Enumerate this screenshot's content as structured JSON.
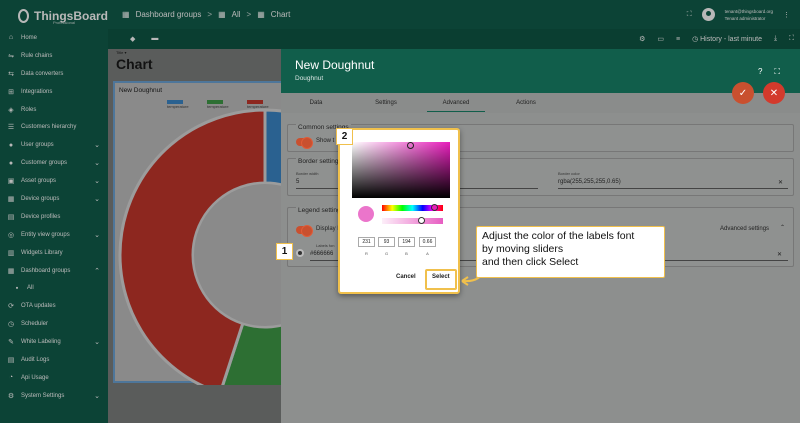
{
  "app": {
    "name": "ThingsBoard",
    "edition": "Professional"
  },
  "breadcrumb": {
    "item1": "Dashboard groups",
    "sep1": ">",
    "item2": "All",
    "sep2": ">",
    "item3": "Chart"
  },
  "user": {
    "email": "tenant@thingsboard.org",
    "role": "Tenant administrator"
  },
  "toolbar": {
    "history": "History - last minute"
  },
  "sidebar": {
    "items": [
      {
        "label": "Home",
        "icon": "home-icon",
        "glyph": "⌂"
      },
      {
        "label": "Rule chains",
        "icon": "rule-chain-icon",
        "glyph": "⇋"
      },
      {
        "label": "Data converters",
        "icon": "converter-icon",
        "glyph": "⇆"
      },
      {
        "label": "Integrations",
        "icon": "integration-icon",
        "glyph": "⊞"
      },
      {
        "label": "Roles",
        "icon": "shield-icon",
        "glyph": "◈"
      },
      {
        "label": "Customers hierarchy",
        "icon": "hierarchy-icon",
        "glyph": "☰"
      },
      {
        "label": "User groups",
        "icon": "users-icon",
        "glyph": "●"
      },
      {
        "label": "Customer groups",
        "icon": "customers-icon",
        "glyph": "●"
      },
      {
        "label": "Asset groups",
        "icon": "asset-icon",
        "glyph": "▣"
      },
      {
        "label": "Device groups",
        "icon": "device-icon",
        "glyph": "▦"
      },
      {
        "label": "Device profiles",
        "icon": "device-profile-icon",
        "glyph": "▤"
      },
      {
        "label": "Entity view groups",
        "icon": "entity-view-icon",
        "glyph": "◎"
      },
      {
        "label": "Widgets Library",
        "icon": "widgets-icon",
        "glyph": "▥"
      },
      {
        "label": "Dashboard groups",
        "icon": "dashboard-icon",
        "glyph": "▦"
      },
      {
        "label": "All",
        "icon": "grid-icon",
        "glyph": "▪"
      },
      {
        "label": "OTA updates",
        "icon": "ota-icon",
        "glyph": "⟳"
      },
      {
        "label": "Scheduler",
        "icon": "clock-icon",
        "glyph": "◷"
      },
      {
        "label": "White Labeling",
        "icon": "brush-icon",
        "glyph": "✎"
      },
      {
        "label": "Audit Logs",
        "icon": "audit-icon",
        "glyph": "▤"
      },
      {
        "label": "Api Usage",
        "icon": "usage-icon",
        "glyph": "◔"
      },
      {
        "label": "System Settings",
        "icon": "gear-icon",
        "glyph": "⚙"
      }
    ]
  },
  "dashboard": {
    "title_small": "Title ▾",
    "title": "Chart"
  },
  "widget": {
    "title": "New Doughnut",
    "legend": [
      {
        "label": "temperature",
        "color": "#3b87c8"
      },
      {
        "label": "temperature",
        "color": "#3f9a47"
      },
      {
        "label": "temperature",
        "color": "#c4362c"
      }
    ]
  },
  "panel": {
    "title": "New Doughnut",
    "subtitle": "Doughnut",
    "tabs": [
      "Data",
      "Settings",
      "Advanced",
      "Actions"
    ],
    "common_settings": "Common settings",
    "show_label": "Show t",
    "border_settings": "Border setting",
    "border_width_label": "Border width",
    "border_width": "5",
    "border_color_label": "Border color",
    "border_color": "rgba(255,255,255,0.65)",
    "legend_settings": "Legend setting",
    "display_label": "Display l",
    "advanced_settings": "Advanced settings",
    "labels_font_label": "Labels fon",
    "labels_font_value": "#666666"
  },
  "picker": {
    "r": "231",
    "g": "93",
    "b": "194",
    "a": "0.66",
    "r_label": "R",
    "g_label": "G",
    "b_label": "B",
    "a_label": "A",
    "cancel": "Cancel",
    "select": "Select"
  },
  "annotations": {
    "badge1": "1",
    "badge2": "2",
    "callout_line1": "Adjust the color of the labels font",
    "callout_line2": "by moving sliders",
    "callout_line3": "and then click Select"
  },
  "chart_data": {
    "type": "pie",
    "variant": "doughnut",
    "labels": [
      "temperature",
      "temperature",
      "temperature"
    ],
    "values": [
      10,
      45,
      45
    ],
    "colors": [
      "#3b87c8",
      "#3f9a47",
      "#c4362c"
    ]
  }
}
